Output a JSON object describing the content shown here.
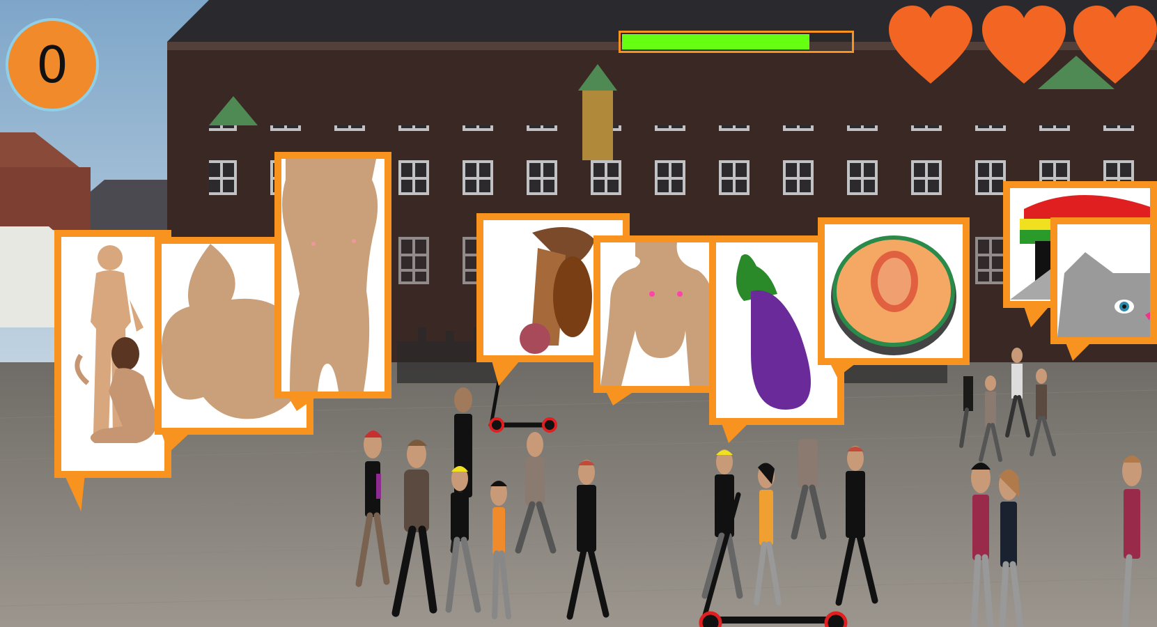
{
  "hud": {
    "score": "0",
    "health_fraction": 0.82,
    "lives": 3,
    "accent": "#f7931e",
    "health_color": "#66ff11",
    "heart_color": "#f26522"
  },
  "bubbles": [
    {
      "name": "bubble-couple",
      "content": "couple-silhouette"
    },
    {
      "name": "bubble-buttocks",
      "content": "buttocks"
    },
    {
      "name": "bubble-torso",
      "content": "female-torso"
    },
    {
      "name": "bubble-phallus",
      "content": "phallus"
    },
    {
      "name": "bubble-breasts",
      "content": "breasts"
    },
    {
      "name": "bubble-eggplant",
      "content": "eggplant"
    },
    {
      "name": "bubble-melon",
      "content": "cantaloupe"
    },
    {
      "name": "bubble-rasta-cat",
      "content": "rasta-cat"
    },
    {
      "name": "bubble-grey-cat",
      "content": "grey-cat"
    }
  ]
}
